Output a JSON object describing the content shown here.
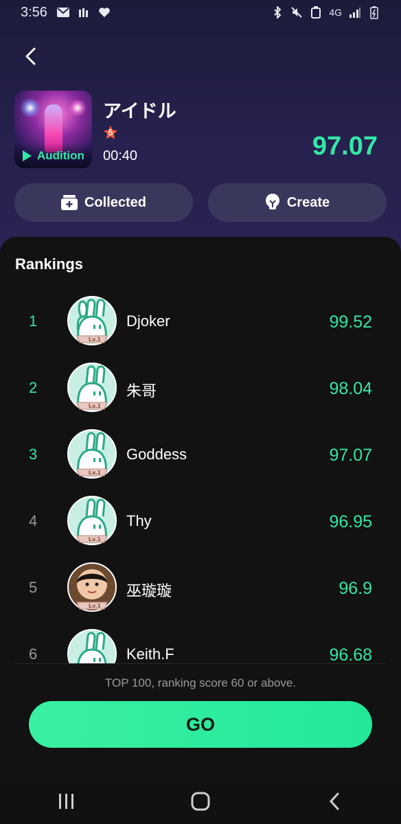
{
  "status_bar": {
    "time": "3:56",
    "network": "4G"
  },
  "song": {
    "title": "アイドル",
    "level": "5",
    "duration": "00:40",
    "score": "97.07",
    "audition_label": "Audition"
  },
  "actions": {
    "collected_label": "Collected",
    "create_label": "Create"
  },
  "rankings": {
    "title": "Rankings",
    "items": [
      {
        "rank": "1",
        "name": "Djoker",
        "score": "99.52",
        "avatar": "bunny-avatar",
        "level_tag": "Lv.1"
      },
      {
        "rank": "2",
        "name": "朱哥",
        "score": "98.04",
        "avatar": "bunny-avatar",
        "level_tag": "Lv.1"
      },
      {
        "rank": "3",
        "name": "Goddess",
        "score": "97.07",
        "avatar": "bunny-avatar",
        "level_tag": "Lv.1"
      },
      {
        "rank": "4",
        "name": "Thy",
        "score": "96.95",
        "avatar": "bunny-avatar",
        "level_tag": "Lv.1"
      },
      {
        "rank": "5",
        "name": "巫璇璇",
        "score": "96.9",
        "avatar": "photo-avatar",
        "level_tag": "Lv.1"
      },
      {
        "rank": "6",
        "name": "Keith.F",
        "score": "96.68",
        "avatar": "bunny-avatar",
        "level_tag": "Lv.1"
      }
    ],
    "footer_note": "TOP 100, ranking score 60 or above."
  },
  "go_label": "GO",
  "colors": {
    "accent": "#33e7a5",
    "header_bg": "#26214e",
    "panel_bg": "#121212",
    "button_bg": "#3a375c",
    "muted_text": "#9a9a9a"
  }
}
